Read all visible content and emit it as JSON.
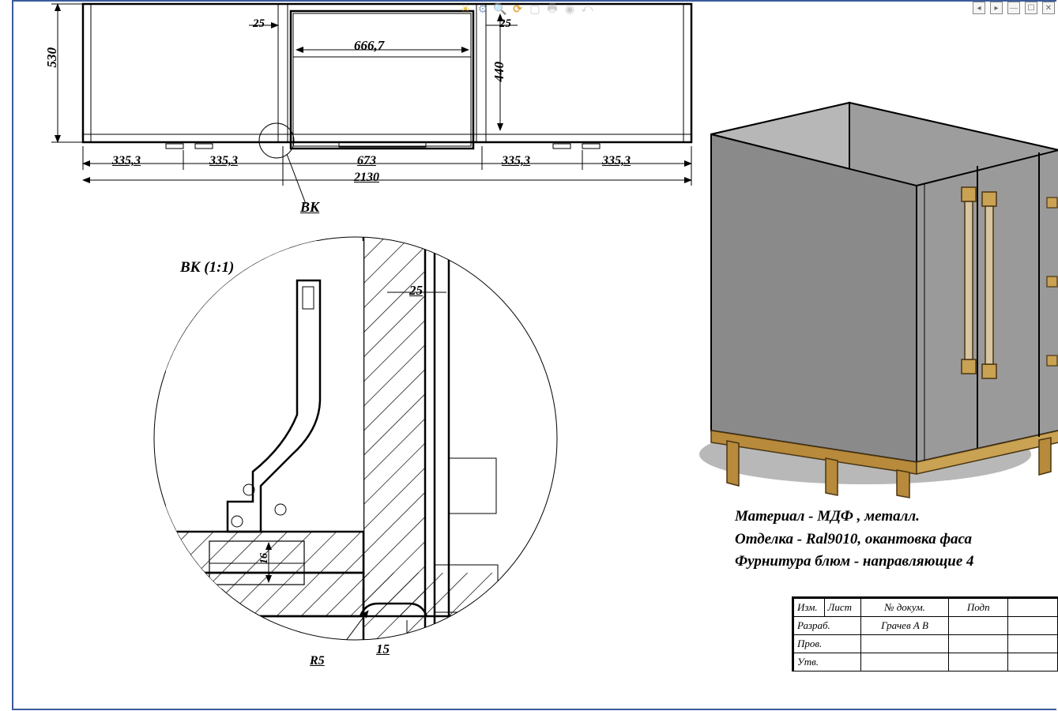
{
  "dims": {
    "h530": "530",
    "d25a": "25",
    "d25b": "25",
    "d666": "666,7",
    "d440": "440",
    "d335a": "335,3",
    "d335b": "335,3",
    "d673": "673",
    "d335c": "335,3",
    "d335d": "335,3",
    "d2130": "2130",
    "d25c": "25",
    "d16": "16",
    "d15": "15",
    "r5": "R5"
  },
  "labels": {
    "bk": "ВК",
    "bk_scale": "ВК (1:1)"
  },
  "notes": {
    "l1": "Материал - МДФ , металл.",
    "l2": "Отделка - Ral9010, окантовка фаса",
    "l3": "Фурнитура блюм - направляющие 4"
  },
  "titleblock": {
    "h1": "Изм.",
    "h2": "Лист",
    "h3": "№ докум.",
    "h4": "Подп",
    "r1": "Разраб.",
    "r1v": "Грачев А В",
    "r2": "Пров.",
    "r3": "Утв."
  }
}
